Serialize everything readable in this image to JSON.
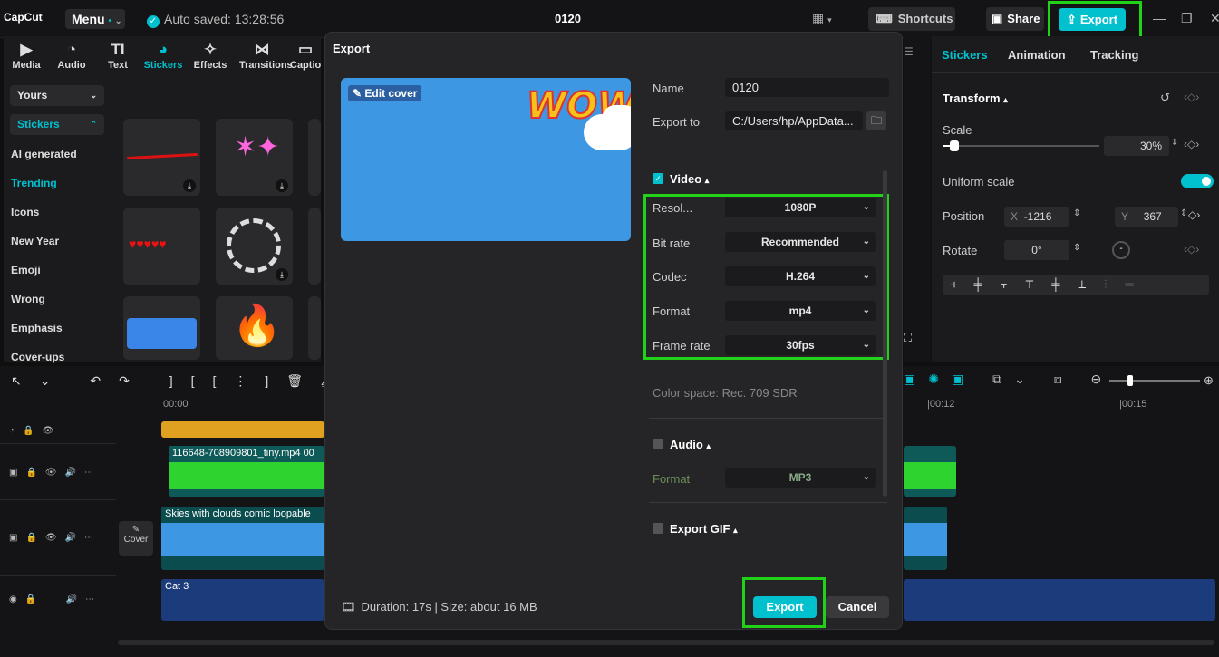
{
  "app": {
    "logo": "CapCut",
    "menu": "Menu",
    "saved": "Auto saved: 13:28:56",
    "title": "0120",
    "shortcuts": "Shortcuts",
    "share": "Share",
    "export": "Export"
  },
  "toolbar": [
    {
      "label": "Media",
      "icon": "media-icon"
    },
    {
      "label": "Audio",
      "icon": "audio-icon"
    },
    {
      "label": "Text",
      "icon": "text-icon"
    },
    {
      "label": "Stickers",
      "icon": "stickers-icon"
    },
    {
      "label": "Effects",
      "icon": "effects-icon"
    },
    {
      "label": "Transitions",
      "icon": "transitions-icon"
    },
    {
      "label": "Captio",
      "icon": "captions-icon"
    }
  ],
  "sidebar": {
    "yours": "Yours",
    "stickers": "Stickers",
    "items": [
      "AI generated",
      "Trending",
      "Icons",
      "New Year",
      "Emoji",
      "Wrong",
      "Emphasis",
      "Cover-ups"
    ]
  },
  "right": {
    "tabs": [
      "Stickers",
      "Animation",
      "Tracking"
    ],
    "transform": "Transform",
    "scale_label": "Scale",
    "scale": "30%",
    "scale_pct": 0.3,
    "uniform": "Uniform scale",
    "position": "Position",
    "x_label": "X",
    "x": "-1216",
    "y_label": "Y",
    "y": "367",
    "rotate": "Rotate",
    "rotate_val": "0°"
  },
  "timeline": {
    "t0": "00:00",
    "t12": "|00:12",
    "t15": "|00:15",
    "clip_video": "116648-708909801_tiny.mp4",
    "clip_video_dur": "00",
    "clip_bg": "Skies with clouds comic loopable",
    "cover": "Cover",
    "clip_audio": "Cat 3"
  },
  "modal": {
    "title": "Export",
    "edit_cover": "Edit cover",
    "name_label": "Name",
    "name": "0120",
    "export_to_label": "Export to",
    "export_to": "C:/Users/hp/AppData...",
    "video": "Video",
    "resolution_label": "Resol...",
    "resolution": "1080P",
    "bitrate_label": "Bit rate",
    "bitrate": "Recommended",
    "codec_label": "Codec",
    "codec": "H.264",
    "format_label": "Format",
    "format": "mp4",
    "framerate_label": "Frame rate",
    "framerate": "30fps",
    "colorspace": "Color space: Rec. 709 SDR",
    "audio": "Audio",
    "audio_format_label": "Format",
    "audio_format": "MP3",
    "gif": "Export GIF",
    "footer": "Duration: 17s | Size: about 16 MB",
    "export": "Export",
    "cancel": "Cancel"
  },
  "colors": {
    "accent": "#00c1cd",
    "highlight": "#22d11a"
  }
}
